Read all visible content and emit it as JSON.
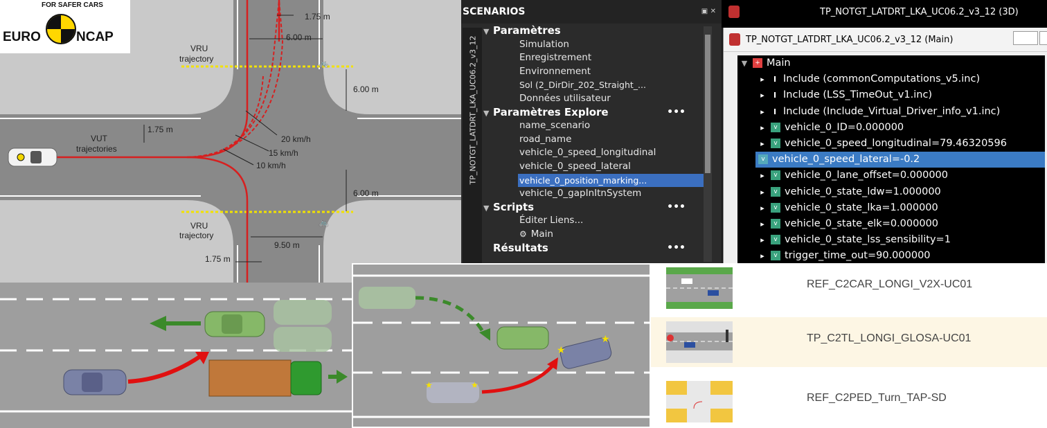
{
  "logo": {
    "brand_left": "EURO",
    "brand_right": "NCAP",
    "tagline": "FOR SAFER CARS"
  },
  "intersection": {
    "vru_top": [
      "VRU",
      "trajectory"
    ],
    "vru_bottom": [
      "VRU",
      "trajectory"
    ],
    "vut": [
      "VUT",
      "trajectories"
    ],
    "dim_175_top": "1.75 m",
    "dim_600_top": "6.00 m",
    "dim_600_right_top": "6.00 m",
    "dim_175_left": "1.75 m",
    "speed_20": "20 km/h",
    "speed_15": "15 km/h",
    "speed_10": "10 km/h",
    "dim_600_right_bottom": "6.00 m",
    "dim_950": "9.50 m",
    "dim_175_bottom": "1.75 m"
  },
  "scenarios": {
    "header": "SCENARIOS",
    "vertical_label": "TP_NOTGT_LATDRT_LKA_UC06.2_v3_12",
    "sections": [
      {
        "label": "Paramètres",
        "items": [
          "Simulation",
          "Enregistrement",
          "Environnement",
          "Sol (2_DirDir_202_Straight_...",
          "Données utilisateur"
        ]
      },
      {
        "label": "Paramètres Explore",
        "dots": "•••",
        "items": [
          "name_scenario",
          "road_name",
          "vehicle_0_speed_longitudinal",
          "vehicle_0_speed_lateral",
          "vehicle_0_position_marking...",
          "vehicle_0_gapInItnSystem"
        ]
      },
      {
        "label": "Scripts",
        "dots": "•••",
        "items": [
          "Éditer Liens...",
          "Main"
        ]
      },
      {
        "label": "Résultats",
        "dots": "•••",
        "items": []
      }
    ]
  },
  "window3d": {
    "title": "TP_NOTGT_LATDRT_LKA_UC06.2_v3_12 (3D)"
  },
  "windowMain": {
    "title": "TP_NOTGT_LATDRT_LKA_UC06.2_v3_12 (Main)",
    "root": "Main",
    "rows": [
      {
        "kind": "include",
        "text": "Include    (commonComputations_v5.inc)"
      },
      {
        "kind": "include",
        "text": "Include    (LSS_TimeOut_v1.inc)"
      },
      {
        "kind": "include",
        "text": "Include    (Include_Virtual_Driver_info_v1.inc)"
      },
      {
        "kind": "var",
        "text": "vehicle_0_ID=0.000000"
      },
      {
        "kind": "var",
        "text": "vehicle_0_speed_longitudinal=79.46320596"
      },
      {
        "kind": "var",
        "text": "vehicle_0_speed_lateral=-0.2"
      },
      {
        "kind": "var",
        "text": "vehicle_0_lane_offset=0.000000"
      },
      {
        "kind": "var",
        "text": "vehicle_0_state_ldw=1.000000"
      },
      {
        "kind": "var",
        "text": "vehicle_0_state_lka=1.000000"
      },
      {
        "kind": "var",
        "text": "vehicle_0_state_elk=0.000000"
      },
      {
        "kind": "var",
        "text": "vehicle_0_state_lss_sensibility=1"
      },
      {
        "kind": "var",
        "text": "trigger_time_out=90.000000"
      }
    ]
  },
  "scenarioList": {
    "items": [
      {
        "label": "REF_C2CAR_LONGI_V2X-UC01"
      },
      {
        "label": "TP_C2TL_LONGI_GLOSA-UC01"
      },
      {
        "label": "REF_C2PED_Turn_TAP-SD"
      }
    ]
  },
  "colors": {
    "road": "#8a8a8a",
    "grass": "#c8c8c8",
    "trajectory": "#d62020",
    "selection": "#3b6fc0"
  }
}
